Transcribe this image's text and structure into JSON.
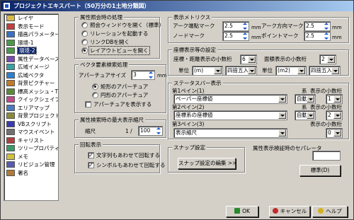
{
  "window": {
    "title": "プロジェクトエキスパート（50万分の1土地分類図）"
  },
  "sidebar": {
    "items": [
      {
        "label": "レイヤ",
        "color": "#d9b84a"
      },
      {
        "label": "表示モード",
        "color": "#c04040"
      },
      {
        "label": "描画パラメーター",
        "color": "#3a6fc2"
      },
      {
        "label": "環境-1",
        "color": "#4a9a4a"
      },
      {
        "label": "環境-2",
        "color": "#4a9a4a",
        "selected": true
      },
      {
        "label": "属性データベース",
        "color": "#7a4ab0"
      },
      {
        "label": "広域イメージ",
        "color": "#3aa0a0"
      },
      {
        "label": "広域ベクタ",
        "color": "#2f7fd0"
      },
      {
        "label": "背景ピクチャー",
        "color": "#c07a2a"
      },
      {
        "label": "標高メッシュ・TIN",
        "color": "#5a8a3a"
      },
      {
        "label": "クイックシェイプ",
        "color": "#c04a8a"
      },
      {
        "label": "エリアマップ",
        "color": "#4a7ac0"
      },
      {
        "label": "背景プロジェクト",
        "color": "#8a8a3a"
      },
      {
        "label": "VBスクリプト",
        "color": "#3a3ab0"
      },
      {
        "label": "マウスイベント",
        "color": "#707070"
      },
      {
        "label": "キャリスト",
        "color": "#b04040"
      },
      {
        "label": "ツリープロパティ",
        "color": "#3a9a6a"
      },
      {
        "label": "メモ",
        "color": "#d0c040"
      },
      {
        "label": "リビジョン管理",
        "color": "#5a5ab0"
      },
      {
        "label": "署名",
        "color": "#b07a3a"
      }
    ]
  },
  "attr_reference": {
    "title": "属性照会時の処理",
    "options": [
      {
        "label": "照会ウィンドウを開く（標準）",
        "checked": false
      },
      {
        "label": "リレーションを起動する",
        "checked": false
      },
      {
        "label": "リンクDBを開く",
        "checked": false
      },
      {
        "label": "レイアウトビューを開く",
        "checked": true
      }
    ]
  },
  "vector_search": {
    "title": "ベクタ要素検索処理",
    "aperture_label": "アパーチュアサイズ",
    "aperture_value": "3",
    "aperture_unit": "mm",
    "shapes": [
      {
        "label": "矩形のアパーチュア",
        "checked": true
      },
      {
        "label": "円形のアパーチュア",
        "checked": false
      }
    ],
    "show_aperture_label": "アパーチュアを表示する",
    "show_aperture_checked": false
  },
  "attr_scale": {
    "title": "属性検索時の最大表示縮尺",
    "scale_label": "縮尺",
    "scale_prefix": "1 /",
    "scale_value": "100"
  },
  "rotation": {
    "title": "回転表示",
    "items": [
      {
        "label": "文字列もあわせて回転する",
        "checked": true
      },
      {
        "label": "シンボルもあわせて回転する",
        "checked": true
      }
    ]
  },
  "display_metrics": {
    "title": "表示メトリクス",
    "arrow_head_label": "アーク端點マーク",
    "arrow_head_value": "2.5",
    "arrow_dir_label": "アーク方向マーク",
    "arrow_dir_value": "2.5",
    "node_label": "ノードマーク",
    "node_value": "2.5",
    "point_label": "ポイントマーク",
    "point_value": "2.5",
    "unit": "mm"
  },
  "coord_display": {
    "title": "座標表示等の設定",
    "coord_decimals_label": "座標・距離表示の小数桁",
    "coord_decimals_value": "6",
    "area_decimals_label": "面積表示の小数桁",
    "area_decimals_value": "2",
    "unit_label": "単位",
    "unit1_value": "(m)",
    "round1_value": "四捨五入",
    "unit2_label": "単位",
    "unit2_value": "(m2)",
    "round2_value": "四捨五入"
  },
  "statusbar": {
    "title": "ステータスバー表示",
    "system_label": "系",
    "decimals_label": "表示の小数桁",
    "panes": [
      {
        "label": "第1ペイン(1)",
        "value": "ペーパー座標値",
        "system": "自動",
        "decimals": "1"
      },
      {
        "label": "第2ペイン(2)",
        "value": "座標系の座標値",
        "system": "自動",
        "decimals": "2"
      },
      {
        "label": "第3ペイン(3)",
        "value": "表示縮尺",
        "system": "",
        "decimals": "0"
      }
    ]
  },
  "snap": {
    "title": "スナップ設定",
    "edit_button": "スナップ設定の編集 >>"
  },
  "separator": {
    "title": "属性表示検証時のセパレータ",
    "value": "",
    "default_button": "標準(D)"
  },
  "footer": {
    "ok_label": "OK",
    "cancel_label": "キャンセル",
    "help_label": "ヘルプ"
  }
}
